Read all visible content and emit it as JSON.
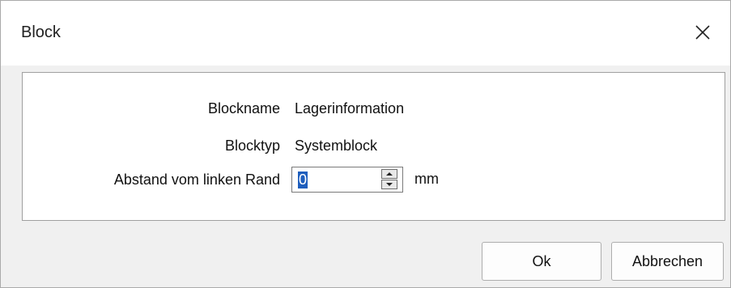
{
  "window": {
    "title": "Block",
    "close_icon": "close-icon"
  },
  "form": {
    "blockname": {
      "label": "Blockname",
      "value": "Lagerinformation"
    },
    "blocktyp": {
      "label": "Blocktyp",
      "value": "Systemblock"
    },
    "abstand": {
      "label": "Abstand vom linken Rand",
      "value": "0",
      "unit": "mm"
    }
  },
  "buttons": {
    "ok": "Ok",
    "cancel": "Abbrechen"
  },
  "colors": {
    "selection": "#1e5ebd",
    "dialog_bg": "#f0f0f0"
  }
}
